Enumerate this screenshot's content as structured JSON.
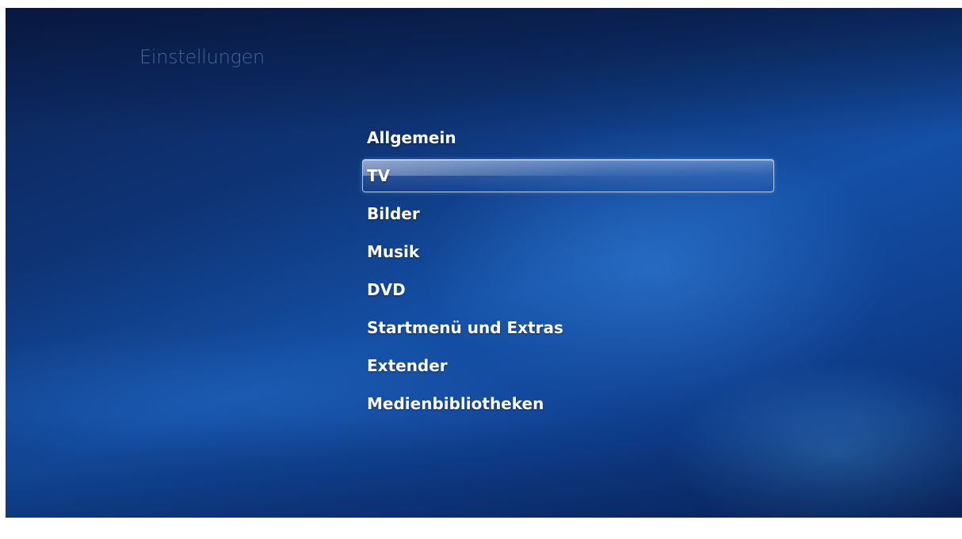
{
  "page": {
    "title": "Einstellungen"
  },
  "menu": {
    "selected_index": 1,
    "items": [
      {
        "label": "Allgemein"
      },
      {
        "label": "TV"
      },
      {
        "label": "Bilder"
      },
      {
        "label": "Musik"
      },
      {
        "label": "DVD"
      },
      {
        "label": "Startmenü und Extras"
      },
      {
        "label": "Extender"
      },
      {
        "label": "Medienbibliotheken"
      }
    ]
  },
  "colors": {
    "background_dark": "#0c2356",
    "background_mid": "#1450a6",
    "title_text": "#789bd2",
    "menu_text": "#ffffff",
    "focus_border": "#c8dcf5"
  }
}
